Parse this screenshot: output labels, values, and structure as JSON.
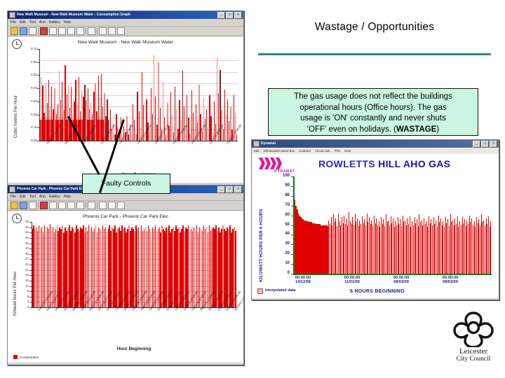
{
  "slide": {
    "headline": "Wastage / Opportunities",
    "accent_color": "#2a8a99"
  },
  "callouts": {
    "gas_line1": "The gas usage does not reflect the buildings",
    "gas_line2": "operational hours (Office hours). The gas",
    "gas_line3": "usage is 'ON' constantly and never shuts",
    "gas_line4_a": "'OFF' even on holidays.  (",
    "gas_line4_b": "WASTAGE",
    "gas_line4_c": ")",
    "faulty_controls": "Faulty Controls",
    "background_color": "#c9f5e1"
  },
  "window_water": {
    "title": "New Walk Museum - New Walk Museum Water - Consumption Graph",
    "menus": [
      "File",
      "Edit",
      "Tool",
      "Ann",
      "Gallery",
      "Help"
    ],
    "minimize": "_",
    "maximize": "□",
    "close": "×",
    "chart_title": "New Walk Museum - New Walk Museum Water",
    "ylabel": "Cubic metres Per Hour",
    "xlabel": "Hour Beginning",
    "yticks": [
      "0.70",
      "0.60",
      "0.50",
      "0.40",
      "0.30",
      "0.20",
      "0.10",
      "0.00"
    ],
    "xticks": [
      "08/02/11 12:00:00",
      "09/02/11 14:00:00",
      "11/02/11 04:00:00",
      "12/02/11 06:00:00",
      "13/02/11 08:00:00",
      "14/02/11 10:00:00",
      "15/02/11 12:00:00",
      "16/02/11 14:00:00",
      "18/02/11 04:00:00",
      "19/02/11 06:00:00",
      "20/02/11 08:00:00"
    ]
  },
  "window_carpark": {
    "title": "Phoenix Car Park - Phoenix Car Park Elec - Consumption Graph",
    "menus": [
      "File",
      "Edit",
      "Tool",
      "Ann",
      "Gallery",
      "Help"
    ],
    "minimize": "_",
    "maximize": "□",
    "close": "×",
    "chart_title": "Phoenix Car Park - Phoenix Car Park Elec",
    "ylabel": "Kilowatt hours Per Hour",
    "xlabel": "Hour Beginning",
    "yticks": [
      "48",
      "45",
      "42",
      "39",
      "36",
      "33",
      "30",
      "27",
      "24",
      "21",
      "18",
      "15",
      "12",
      "9",
      "6",
      "3",
      "0"
    ],
    "legend": "Consumption",
    "xticks": [
      "02/02/11 19:00:00",
      "03/02/11 01:00:00",
      "04/02/11 07:00:00",
      "05/02/11 13:00:00",
      "06/02/11 19:00:00",
      "08/02/11 01:00:00",
      "09/02/11 07:00:00",
      "10/02/11 13:00:00",
      "11/02/11 19:00:00",
      "13/02/11 01:00:00",
      "14/02/11 07:00:00",
      "15/02/11 13:00:00",
      "16/02/11 19:00:00",
      "18/02/11 01:00:00",
      "19/02/11 07:00:00",
      "20/02/11 13:00:00",
      "21/02/11 19:00:00",
      "23/02/11 01:00:00",
      "24/02/11 07:00:00",
      "25/02/11 13:00:00",
      "26/02/11 19:00:00",
      "28/02/11 01:00:00",
      "01/03/11 07:00:00",
      "02/03/11 13:00:00"
    ]
  },
  "window_dynamat": {
    "title": "Dynamat",
    "menus": [
      "Edit",
      "Wholesale/Control Box",
      "Contract",
      "Circuit Link",
      "PTE",
      "Help"
    ],
    "minimize": "_",
    "maximize": "□",
    "close": "×",
    "brand": "DYNAMAT",
    "brand_color": "#e0189a",
    "chart_title_a": "ROWLETTS",
    "chart_title_b": "HILL AHO GAS",
    "ylabel": "KILOWATT HOURS PER 6 HOURS",
    "xlabel": "6 HOURS BEGINNING",
    "yticks": [
      "100",
      "90",
      "80",
      "70",
      "60",
      "50",
      "40",
      "30",
      "20",
      "10",
      "0"
    ],
    "legend": "Interpolated data",
    "xticks": [
      {
        "time": "00:00:00",
        "date": "14/12/08"
      },
      {
        "time": "00:00:00",
        "date": "11/01/09"
      },
      {
        "time": "00:00:00",
        "date": "08/02/09"
      },
      {
        "time": "00:00:00",
        "date": "08/03/09"
      }
    ],
    "title_color": "#2a2ad0"
  },
  "logo": {
    "line1": "Leicester",
    "line2": "City Council"
  },
  "chart_data": [
    {
      "type": "bar",
      "title": "New Walk Museum - New Walk Museum Water",
      "ylabel": "Cubic metres Per Hour",
      "xlabel": "Hour Beginning",
      "ylim": [
        0,
        0.75
      ],
      "baseline_block": 0.17,
      "values": [
        0.3,
        0.52,
        0.45,
        0.23,
        0.47,
        0.31,
        0.5,
        0.28,
        0.44,
        0.26,
        0.43,
        0.22,
        0.3,
        0.57,
        0.33,
        0.48,
        0.25,
        0.62,
        0.38,
        0.45,
        0.27,
        0.44,
        0.21,
        0.32,
        0.5,
        0.29,
        0.52,
        0.24,
        0.41,
        0.36,
        0.46,
        0.33,
        0.43,
        0.26,
        0.31,
        0.22,
        0.4,
        0.47,
        0.24,
        0.53,
        0.35,
        0.55,
        0.28,
        0.39,
        0.2,
        0.34,
        0.18,
        0.26,
        0.09,
        0.14,
        0.05,
        0.22,
        0.11,
        0.06,
        0.19,
        0.03,
        0.12,
        0.07,
        0.2,
        0.05,
        0.13,
        0.08,
        0.3,
        0.17,
        0.05,
        0.4,
        0.24,
        0.11,
        0.56,
        0.29,
        0.06,
        0.34,
        0.15,
        0.08,
        0.43,
        0.22,
        0.7,
        0.36,
        0.13,
        0.64,
        0.27,
        0.09,
        0.48,
        0.19,
        0.05,
        0.31,
        0.12,
        0.4,
        0.21,
        0.07,
        0.44,
        0.26,
        0.1,
        0.33,
        0.17,
        0.57,
        0.28,
        0.12,
        0.37,
        0.19,
        0.06,
        0.41,
        0.23,
        0.09,
        0.3,
        0.15,
        0.46,
        0.22,
        0.08,
        0.35,
        0.18,
        0.26,
        0.11,
        0.37,
        0.2,
        0.07,
        0.32,
        0.14,
        0.68,
        0.39,
        0.58,
        0.25,
        0.1,
        0.42,
        0.21,
        0.34,
        0.16,
        0.28,
        0.09,
        0.37,
        0.23,
        0.05
      ],
      "gap_index": 46
    },
    {
      "type": "bar",
      "title": "Phoenix Car Park - Phoenix Car Park Elec",
      "ylabel": "Kilowatt hours Per Hour",
      "xlabel": "Hour Beginning",
      "ylim": [
        0,
        48
      ],
      "legend": "Consumption",
      "values": [
        44,
        46,
        44,
        45,
        43,
        46,
        44,
        45,
        42,
        46,
        43,
        45,
        44,
        47,
        43,
        45,
        42,
        44,
        46,
        43,
        45,
        44,
        46,
        42,
        45,
        43,
        44,
        46,
        43,
        45,
        44,
        42,
        46,
        44,
        43,
        45,
        44,
        46,
        42,
        45,
        43,
        46,
        44,
        45,
        43,
        44,
        46,
        42,
        45,
        44,
        43,
        46,
        44,
        45,
        42,
        44,
        46,
        43,
        45,
        44,
        46,
        42,
        44,
        45,
        43,
        46,
        44,
        45,
        42,
        44,
        46,
        43,
        45,
        44,
        43,
        46,
        44,
        45,
        42,
        46,
        43,
        44,
        45,
        43,
        46,
        44,
        42,
        45,
        44,
        46,
        43,
        44,
        45,
        42,
        46,
        44,
        43,
        45,
        44,
        46,
        42,
        44,
        45,
        43,
        46,
        44,
        45,
        42,
        44,
        46,
        43,
        45,
        44,
        46,
        42,
        44,
        43,
        45,
        44,
        46,
        42,
        45,
        44,
        43,
        46,
        44,
        45,
        42,
        46,
        43,
        44,
        45,
        44,
        46,
        43,
        45,
        42,
        44,
        46,
        44,
        43,
        45,
        44,
        46,
        42,
        44,
        45,
        43
      ]
    },
    {
      "type": "area",
      "title": "ROWLETTS HILL AHO GAS",
      "ylabel": "KILOWATT HOURS PER 6 HOURS",
      "xlabel": "6 HOURS BEGINNING",
      "ylim": [
        0,
        100
      ],
      "legend": "Interpolated data",
      "values": [
        76,
        70,
        66,
        62,
        60,
        58,
        57,
        56,
        55,
        55,
        54,
        54,
        53,
        53,
        53,
        52,
        52,
        52,
        51,
        51,
        51,
        51,
        50,
        50,
        50,
        50,
        50,
        50,
        49,
        55,
        52,
        58,
        50,
        61,
        53,
        57,
        49,
        62,
        54,
        50,
        58,
        52,
        60,
        51,
        56,
        50,
        63,
        54,
        52,
        58,
        50,
        61,
        53,
        57,
        49,
        55,
        51,
        59,
        52,
        56,
        50,
        62,
        53,
        58,
        51,
        55,
        49,
        60,
        52,
        57,
        50,
        54,
        48,
        58,
        51,
        56,
        49,
        61,
        53,
        55,
        50,
        59,
        52,
        57,
        48,
        54,
        50,
        58,
        51,
        56,
        49,
        60,
        53,
        55,
        50,
        57,
        51,
        59,
        48,
        54,
        50,
        58,
        52,
        56,
        49,
        61,
        53,
        55,
        50,
        57,
        51,
        54,
        48,
        59,
        52,
        56,
        50,
        58,
        51,
        55,
        49,
        60,
        53,
        57,
        50,
        54,
        48,
        58,
        52,
        56,
        49,
        61,
        53,
        55,
        50,
        57,
        51,
        59,
        48,
        54,
        50,
        58,
        52,
        56,
        49,
        55,
        51,
        60,
        53,
        57,
        50,
        54,
        48,
        58,
        52,
        56,
        49,
        61,
        53,
        55,
        50,
        57,
        51,
        59,
        48,
        54
      ]
    }
  ]
}
